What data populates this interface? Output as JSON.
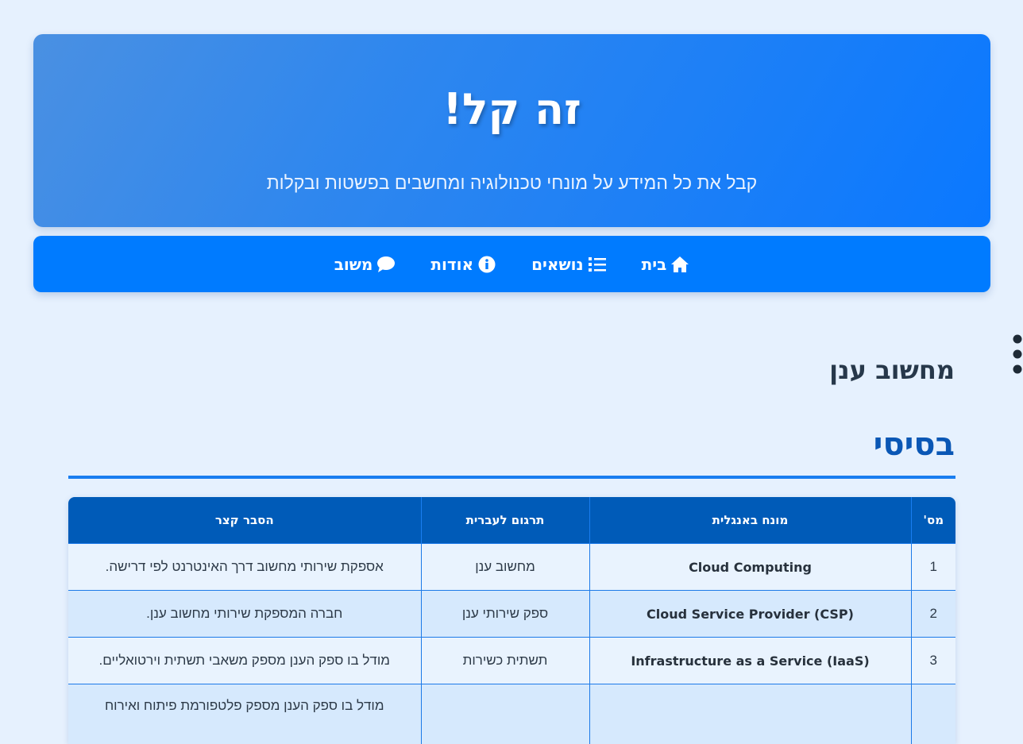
{
  "hero": {
    "title": "זה קל!",
    "subtitle": "קבל את כל המידע על מונחי טכנולוגיה ומחשבים בפשטות ובקלות"
  },
  "nav": {
    "items": [
      {
        "label": "בית",
        "icon": "home-icon"
      },
      {
        "label": "נושאים",
        "icon": "list-icon"
      },
      {
        "label": "אודות",
        "icon": "info-circle-icon"
      },
      {
        "label": "משוב",
        "icon": "comment-icon"
      }
    ]
  },
  "page": {
    "section_title": "מחשוב ענן",
    "subsection_title": "בסיסי"
  },
  "table": {
    "headers": [
      "מס'",
      "מונח באנגלית",
      "תרגום לעברית",
      "הסבר קצר"
    ],
    "rows": [
      {
        "num": "1",
        "term": "Cloud Computing",
        "hebrew": "מחשוב ענן",
        "desc": "אספקת שירותי מחשוב דרך האינטרנט לפי דרישה."
      },
      {
        "num": "2",
        "term": "Cloud Service Provider (CSP)",
        "hebrew": "ספק שירותי ענן",
        "desc": "חברה המספקת שירותי מחשוב ענן."
      },
      {
        "num": "3",
        "term": "Infrastructure as a Service (IaaS)",
        "hebrew": "תשתית כשירות",
        "desc": "מודל בו ספק הענן מספק משאבי תשתית וירטואליים."
      },
      {
        "num": "",
        "term": "",
        "hebrew": "",
        "desc": "מודל בו ספק הענן מספק פלטפורמת פיתוח ואירוח"
      }
    ]
  },
  "colors": {
    "background": "#e6f1fe",
    "nav": "#007bff",
    "table_header": "#005bb8",
    "accent": "#0a57b5"
  }
}
